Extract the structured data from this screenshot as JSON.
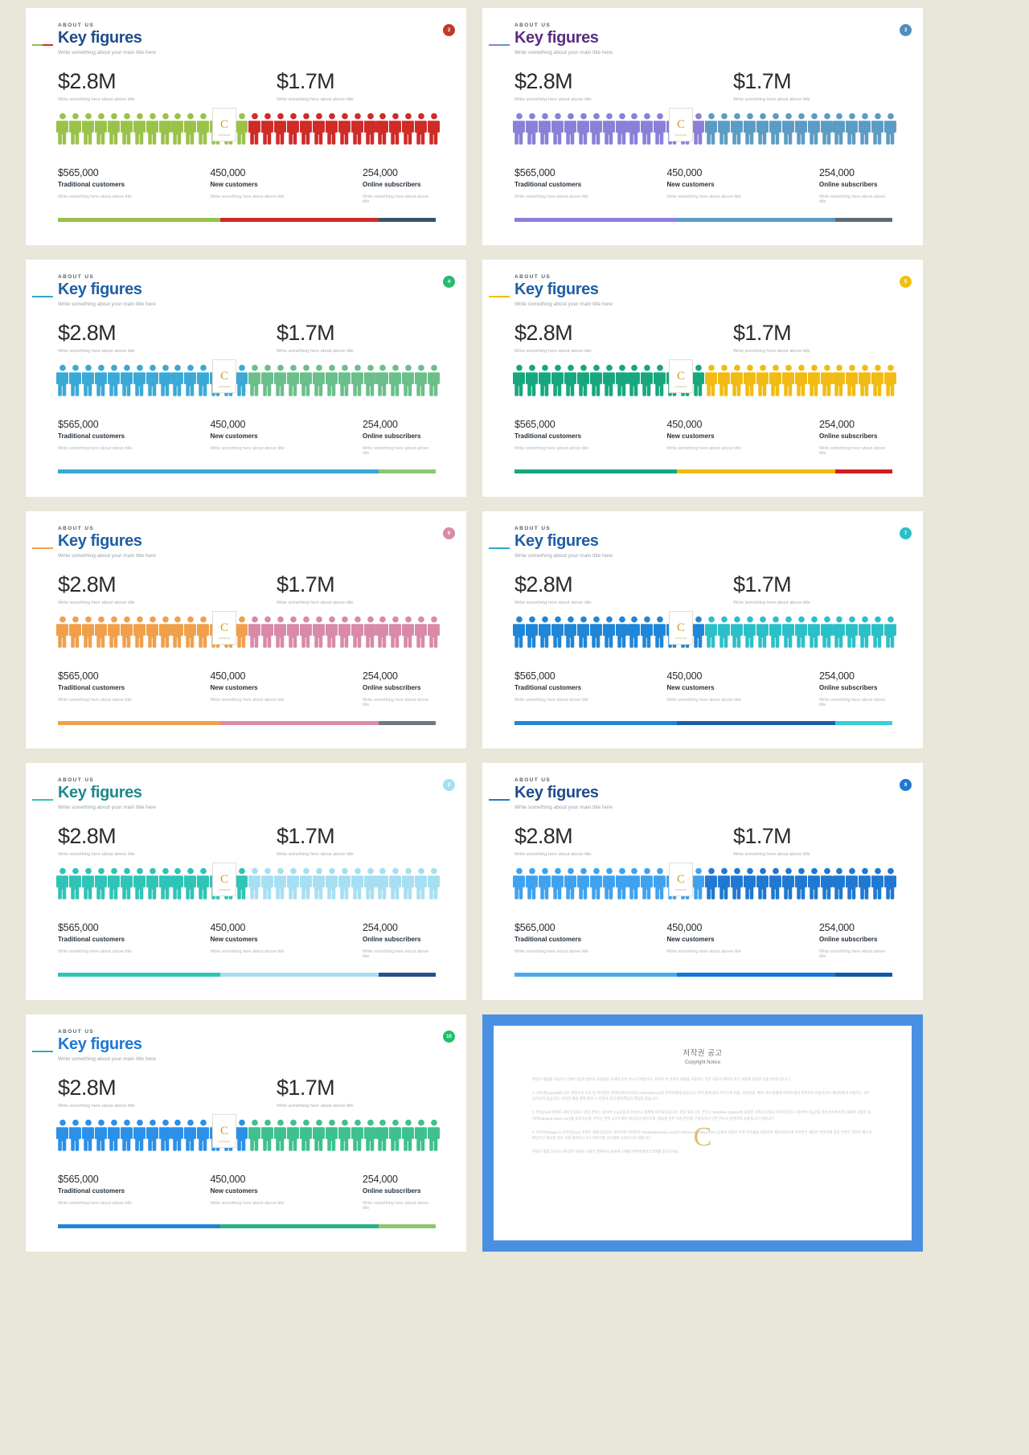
{
  "page": {
    "background": "#e9e6da",
    "columns": 2,
    "slide_count": 10
  },
  "common": {
    "kicker": "ABOUT US",
    "title": "Key figures",
    "subtitle": "Write something about your main title here",
    "big_caption": "Write something here about above title",
    "stat_note": "Write something here about above title",
    "seal_glyph": "C",
    "seal_caption": "COPYRIGHT",
    "big_figures": [
      {
        "value": "$2.8M",
        "caption": "Write something here about above title"
      },
      {
        "value": "$1.7M",
        "caption": "Write something here about above title"
      }
    ],
    "stats": [
      {
        "value": "$565,000",
        "label": "Traditional customers",
        "note": "Write something here about above title"
      },
      {
        "value": "450,000",
        "label": "New customers",
        "note": "Write something here about above title"
      },
      {
        "value": "254,000",
        "label": "Online subscribers",
        "note": "Write something here about above title"
      }
    ],
    "people_total": 30,
    "people_split": 15,
    "bar_segments_pct": [
      43,
      42,
      15
    ]
  },
  "slides": [
    {
      "id": "slide-2",
      "badge": "2",
      "badge_color": "#c0392b",
      "title_color": "#1f4e8c",
      "rule_colors": [
        "#8cbf45",
        "#c0392b"
      ],
      "people_left": "#8cc councillor"
    },
    {
      "id": "slide-3",
      "badge": "3",
      "badge_color": "#4f8fbf",
      "title_color": "#5b2d82",
      "rule_colors": [
        "#8b83d6",
        "#5b9bc4"
      ]
    },
    {
      "id": "slide-4",
      "badge": "4",
      "badge_color": "#2eb872",
      "title_color": "#1f5fa8",
      "rule_colors": [
        "#2aa9c9",
        "#2aa9c9"
      ]
    },
    {
      "id": "slide-5",
      "badge": "5",
      "badge_color": "#f2c014",
      "title_color": "#1f5fa8",
      "rule_colors": [
        "#f2c014",
        "#f2c014"
      ]
    },
    {
      "id": "slide-6",
      "badge": "6",
      "badge_color": "#d98aa8",
      "title_color": "#1f5fa8",
      "rule_colors": [
        "#f0a04b",
        "#f0a04b"
      ]
    },
    {
      "id": "slide-7",
      "badge": "7",
      "badge_color": "#2bc0c8",
      "title_color": "#1f5fa8",
      "rule_colors": [
        "#2aa9c9",
        "#2aa9c9"
      ]
    },
    {
      "id": "slide-8",
      "badge": "8",
      "badge_color": "#a6dff2",
      "title_color": "#1f8a8a",
      "rule_colors": [
        "#2ec4b6",
        "#2ec4b6"
      ]
    },
    {
      "id": "slide-9",
      "badge": "9",
      "badge_color": "#1f78d1",
      "title_color": "#1f4e8c",
      "rule_colors": [
        "#1f78d1",
        "#1f78d1"
      ]
    },
    {
      "id": "slide-10",
      "badge": "10",
      "badge_color": "#1fbf6b",
      "title_color": "#1f78d1",
      "rule_colors": [
        "#2aa9c9",
        "#2aa9c9"
      ]
    }
  ],
  "palettes": [
    {
      "people_a": "#9ac24a",
      "people_b": "#cf2b27",
      "bar": [
        "#9ac24a",
        "#cf2b27",
        "#39536b"
      ]
    },
    {
      "people_a": "#8a80d8",
      "people_b": "#5c9cc4",
      "bar": [
        "#8a80d8",
        "#5c9cc4",
        "#5d6b72"
      ]
    },
    {
      "people_a": "#3aa9d6",
      "people_b": "#6bbf8a",
      "bar": [
        "#3aa9d6",
        "#3aa9d6",
        "#8cc86f"
      ]
    },
    {
      "people_a": "#17a77e",
      "people_b": "#f2bb13",
      "bar": [
        "#17a77e",
        "#f2bb13",
        "#cf1f1f"
      ]
    },
    {
      "people_a": "#f0a04b",
      "people_b": "#d98aa8",
      "bar": [
        "#f0a04b",
        "#d98aa8",
        "#6a7a85"
      ]
    },
    {
      "people_a": "#1f86d8",
      "people_b": "#2bc0c8",
      "bar": [
        "#1f86d8",
        "#1f5fa8",
        "#36d0d8"
      ]
    },
    {
      "people_a": "#2ec4b6",
      "people_b": "#a6dff2",
      "bar": [
        "#2ec4b6",
        "#a6dff2",
        "#23528c"
      ]
    },
    {
      "people_a": "#3fa2ef",
      "people_b": "#1f78d1",
      "bar": [
        "#4aa8f0",
        "#1277d6",
        "#0d5aa8"
      ]
    },
    {
      "people_a": "#2b90e8",
      "people_b": "#3fc08f",
      "bar": [
        "#1f86d8",
        "#2bb089",
        "#8cc86f"
      ]
    }
  ],
  "copyright": {
    "title": "저작권 공고",
    "subtitle": "Copyright Notice",
    "mark": "C",
    "paragraphs": [
      "콘텐츠 제품을 사용하기 전에 다음의 법적과 조항들을 자세히 읽어 주시기 바랍니다. 귀하가 이 콘텐츠 제품을 사용하는 것은 사용자 계약의 모든 내용에 동의한 것을 알려드립니다.",
      "1. 저작권(copyright) 모든 콘텐츠의 소유 및 저작권은 콘텐츠레이코리아(contentslaeou)의 저작자에게 있습니다. 저작 물에 없이 무단으로 이용, 저작전송, 배포 기타 방법에 의하여 영리 목적으로 이용하거나 재산자체의 이용하는 것은 금지되어 있습니다. 이러한 불법 행위 발견 시 민형사 상의 법적책임의 책임을 받습니다.",
      "2. 폰트(font) 콘텐츠 내에 삽입되는 한글 폰트는 네이버 나눔글꼴의 라이선스 정책에 저작되었습니다. 한글 외의 모든 폰트는 Windows System에 포함된 저작의 글꼴로 저작되었으나 네이버 나눔글꼴 라이선스에 따른 자세한 사항은 네이버(hangeul.naver.com)를 참조하시길. 폰트는 관련 소프트웨어 제공되어 않으므로, 필요할 경우 직접 폰트를 구입하거나 다른 폰트로 변경하여 사용하시기 바랍니다.",
      "3. 이미지(image) & 아이콘(icon) 콘텐츠 내에 삽입되는 이미지와 아이콘은 Pixabay(pixabay.com)와 Webanotsvetalyo.com) 등에서 제공한 무료 저작물을 이용하여 제작되었으며 아이콘은 제공된 콘텐츠에 의한 콘텐츠 권한이 별도로 확인하고 필요할 경우 직접 제작하시거나 이미지를 인터넷에 사용하시기 바랍니다.",
      "콘텐츠 제품 라이선스에 대한 자세한 사항은 홈페이지 회원에 기재한 콘텐츠레이코리아를 참조하세요."
    ]
  }
}
